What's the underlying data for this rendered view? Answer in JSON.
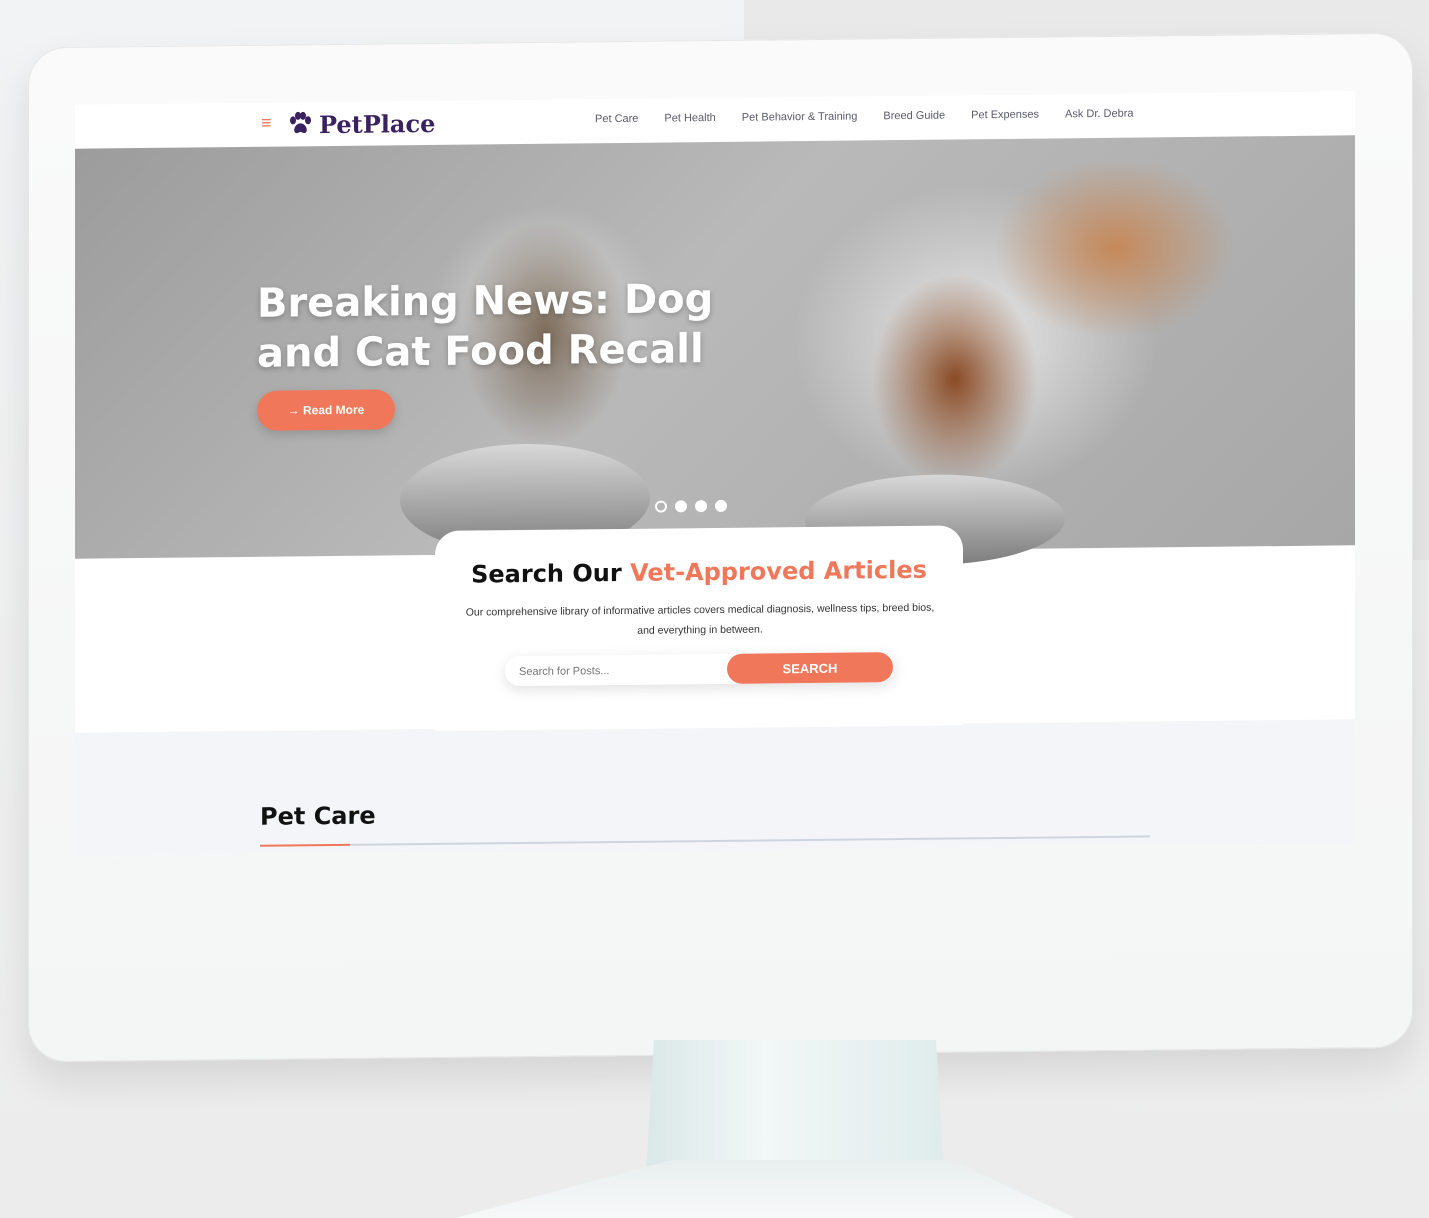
{
  "brand": {
    "name": "PetPlace",
    "accent_color": "#f1775a",
    "logo_color": "#3a2160"
  },
  "nav": {
    "items": [
      "Pet Care",
      "Pet Health",
      "Pet Behavior & Training",
      "Breed Guide",
      "Pet Expenses",
      "Ask Dr. Debra"
    ]
  },
  "hero": {
    "title": "Breaking News: Dog and Cat Food Recall",
    "button_label": "→ Read More",
    "slides_total": 4,
    "active_slide": 1
  },
  "search": {
    "title_prefix": "Search Our ",
    "title_accent": "Vet-Approved Articles",
    "description": "Our comprehensive library of informative articles covers medical diagnosis, wellness tips, breed bios, and everything in between.",
    "placeholder": "Search for Posts...",
    "button_label": "SEARCH"
  },
  "section": {
    "title": "Pet Care"
  },
  "icons": {
    "menu": "hamburger-icon",
    "logo": "paw-icon"
  }
}
